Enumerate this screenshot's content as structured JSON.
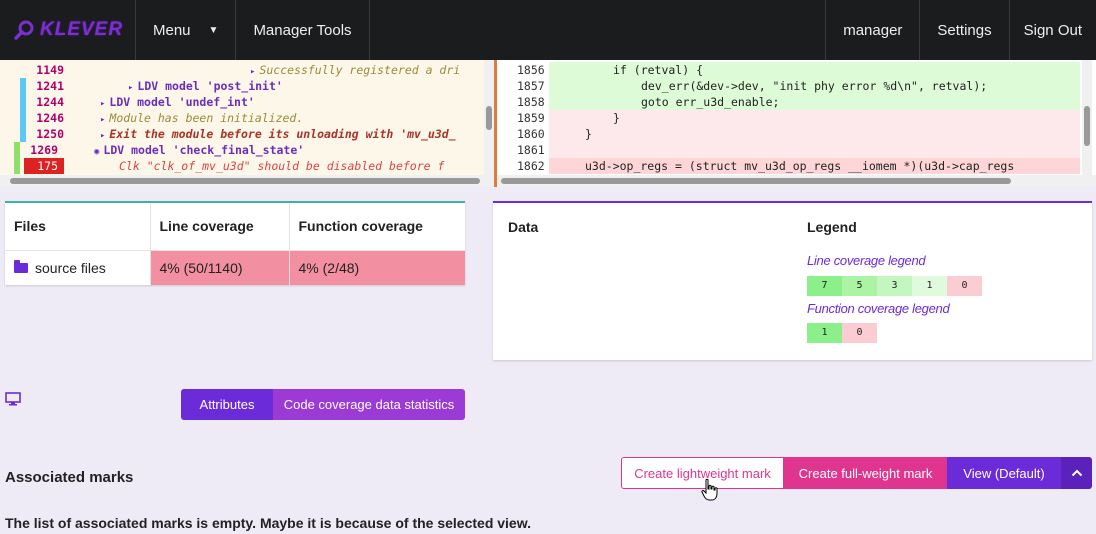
{
  "navbar": {
    "logo_text": "KLEVER",
    "menu_label": "Menu",
    "manager_tools_label": "Manager Tools",
    "user_label": "manager",
    "settings_label": "Settings",
    "signout_label": "Sign Out"
  },
  "error_trace": {
    "lines": [
      {
        "num": "1149",
        "text": "Successfully registered a dri",
        "style": "note",
        "indent": 180
      },
      {
        "num": "1241",
        "text": "LDV model 'post_init'",
        "style": "model",
        "indent": 58
      },
      {
        "num": "1244",
        "text": "LDV model 'undef_int'",
        "style": "model",
        "indent": 30
      },
      {
        "num": "1246",
        "text": "Module has been initialized.",
        "style": "note",
        "indent": 30
      },
      {
        "num": "1250",
        "text": "Exit the module before its unloading with 'mv_u3d_",
        "style": "exit",
        "indent": 30
      },
      {
        "num": "1269",
        "text": "LDV model 'check_final_state'",
        "style": "model-eye",
        "indent": 30
      },
      {
        "num": "175",
        "text": "Clk \"clk_of_mv_u3d\" should be disabled before f",
        "style": "error",
        "indent": 55
      }
    ]
  },
  "source_code": {
    "lines": [
      {
        "num": "1856",
        "code": "if (retval) {",
        "bg": "green"
      },
      {
        "num": "1857",
        "code": "dev_err(&dev->dev, \"init phy error %d\\n\", retval);",
        "bg": "green"
      },
      {
        "num": "1858",
        "code": "goto err_u3d_enable;",
        "bg": "green"
      },
      {
        "num": "1859",
        "code": "}",
        "bg": "pink"
      },
      {
        "num": "1860",
        "code": "}",
        "bg": "pink"
      },
      {
        "num": "1861",
        "code": "",
        "bg": "pink"
      },
      {
        "num": "1862",
        "code": "u3d->op_regs = (struct mv_u3d_op_regs __iomem *)(u3d->cap_regs",
        "bg": "red"
      }
    ]
  },
  "files_table": {
    "headers": [
      "Files",
      "Line coverage",
      "Function coverage"
    ],
    "rows": [
      {
        "name": "source files",
        "line_cov": "4% (50/1140)",
        "func_cov": "4% (2/48)"
      }
    ]
  },
  "data_card": {
    "data_header": "Data",
    "legend_header": "Legend",
    "line_legend_title": "Line coverage legend",
    "line_legend": [
      {
        "label": "7",
        "color": "#8cf08a"
      },
      {
        "label": "5",
        "color": "#aaf4a4"
      },
      {
        "label": "3",
        "color": "#c4f7bf"
      },
      {
        "label": "1",
        "color": "#dffadc"
      },
      {
        "label": "0",
        "color": "#fbcdd2"
      }
    ],
    "func_legend_title": "Function coverage legend",
    "func_legend": [
      {
        "label": "1",
        "color": "#8cf08a"
      },
      {
        "label": "0",
        "color": "#fbcdd2"
      }
    ]
  },
  "tabs": {
    "attributes_label": "Attributes",
    "coverage_stats_label": "Code coverage data statistics"
  },
  "marks": {
    "title": "Associated marks",
    "create_lightweight_label": "Create lightweight mark",
    "create_fullweight_label": "Create full-weight mark",
    "view_label": "View (Default)",
    "empty_message": "The list of associated marks is empty. Maybe it is because of the selected view."
  },
  "colors": {
    "brand_purple": "#6c2bd9",
    "brand_pink": "#e0358f",
    "navbar_bg": "#1b1c1d",
    "coverage_bad": "#f28fa1"
  }
}
